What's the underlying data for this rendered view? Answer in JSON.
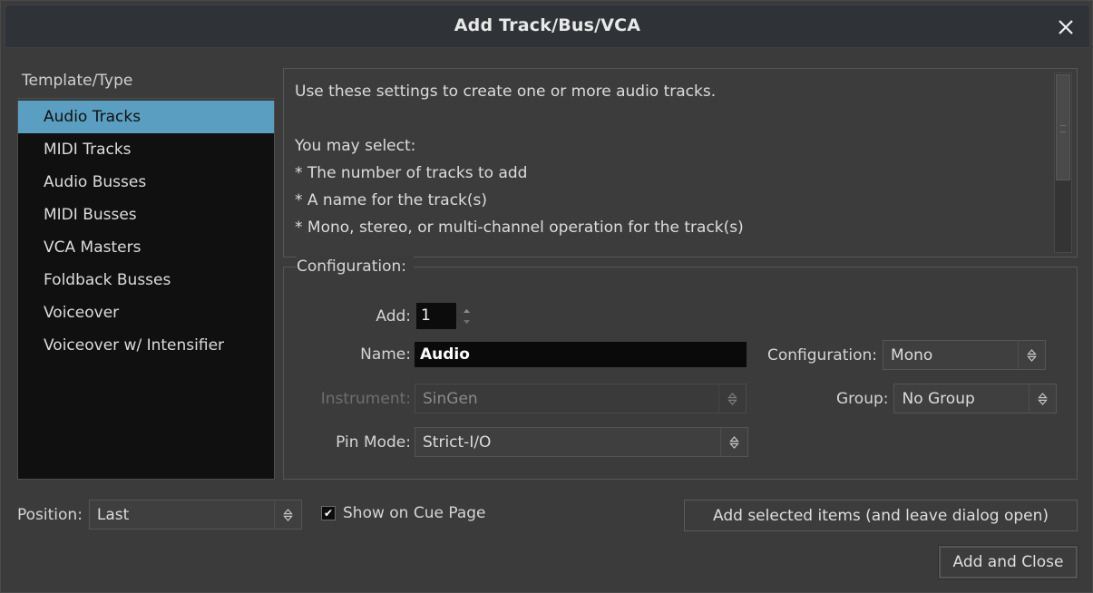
{
  "window": {
    "title": "Add Track/Bus/VCA",
    "close_icon": "close-icon"
  },
  "sidebar": {
    "header": "Template/Type",
    "selected_index": 0,
    "items": [
      {
        "label": "Audio Tracks"
      },
      {
        "label": "MIDI Tracks"
      },
      {
        "label": "Audio Busses"
      },
      {
        "label": "MIDI Busses"
      },
      {
        "label": "VCA Masters"
      },
      {
        "label": "Foldback Busses"
      },
      {
        "label": "Voiceover"
      },
      {
        "label": "Voiceover w/ Intensifier"
      }
    ]
  },
  "description": {
    "text": "Use these settings to create one or more audio tracks.\n\nYou may select:\n* The number of tracks to add\n* A name for the track(s)\n* Mono, stereo, or multi-channel operation for the track(s)"
  },
  "configuration": {
    "legend": "Configuration:",
    "add": {
      "label": "Add:",
      "value": "1"
    },
    "name": {
      "label": "Name:",
      "value": "Audio"
    },
    "config_select": {
      "label": "Configuration:",
      "value": "Mono"
    },
    "instrument": {
      "label": "Instrument:",
      "value": "SinGen",
      "disabled": true
    },
    "group": {
      "label": "Group:",
      "value": "No Group"
    },
    "pin_mode": {
      "label": "Pin Mode:",
      "value": "Strict-I/O"
    }
  },
  "footer": {
    "position": {
      "label": "Position:",
      "value": "Last"
    },
    "show_on_cue_page": {
      "label": "Show on Cue Page",
      "checked": true,
      "check_glyph": "✔"
    },
    "add_selected_button": "Add selected items (and leave dialog open)",
    "add_and_close_button": "Add and Close"
  },
  "colors": {
    "selection": "#5a9fc1",
    "dialog_bg": "#3b3b3b",
    "list_bg": "#101010",
    "entry_bg": "#0a0a0a"
  }
}
